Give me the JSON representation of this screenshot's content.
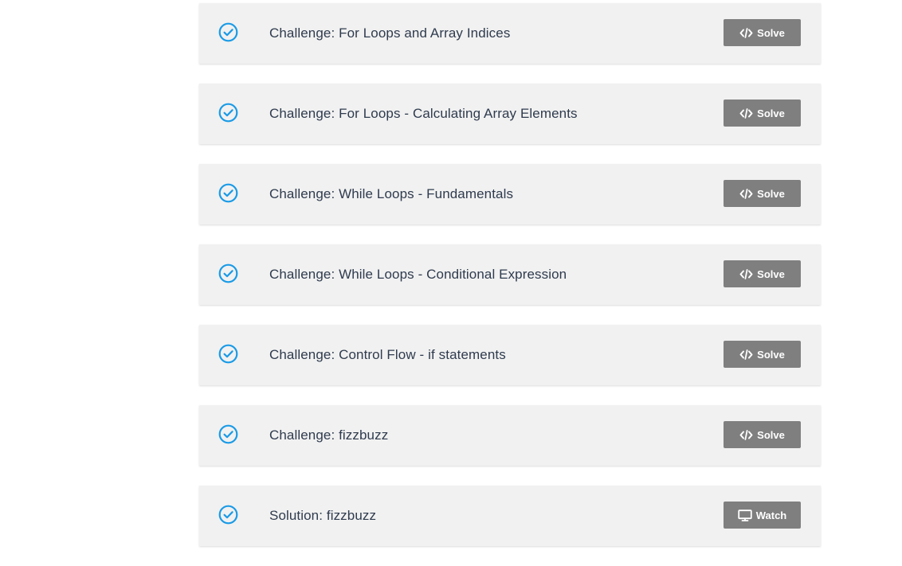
{
  "lessons": [
    {
      "title": "Challenge: For Loops and Array Indices",
      "action": "Solve",
      "icon": "code-icon",
      "completed": true
    },
    {
      "title": "Challenge: For Loops - Calculating Array Elements",
      "action": "Solve",
      "icon": "code-icon",
      "completed": true
    },
    {
      "title": "Challenge: While Loops - Fundamentals",
      "action": "Solve",
      "icon": "code-icon",
      "completed": true
    },
    {
      "title": "Challenge: While Loops - Conditional Expression",
      "action": "Solve",
      "icon": "code-icon",
      "completed": true
    },
    {
      "title": "Challenge: Control Flow - if statements",
      "action": "Solve",
      "icon": "code-icon",
      "completed": true
    },
    {
      "title": "Challenge: fizzbuzz",
      "action": "Solve",
      "icon": "code-icon",
      "completed": true
    },
    {
      "title": "Solution: fizzbuzz",
      "action": "Watch",
      "icon": "monitor-icon",
      "completed": true
    }
  ],
  "colors": {
    "check": "#1a9be6",
    "button_bg": "#7f7f7f",
    "card_bg": "#f1f1f1",
    "title_text": "#2f3b4e"
  }
}
